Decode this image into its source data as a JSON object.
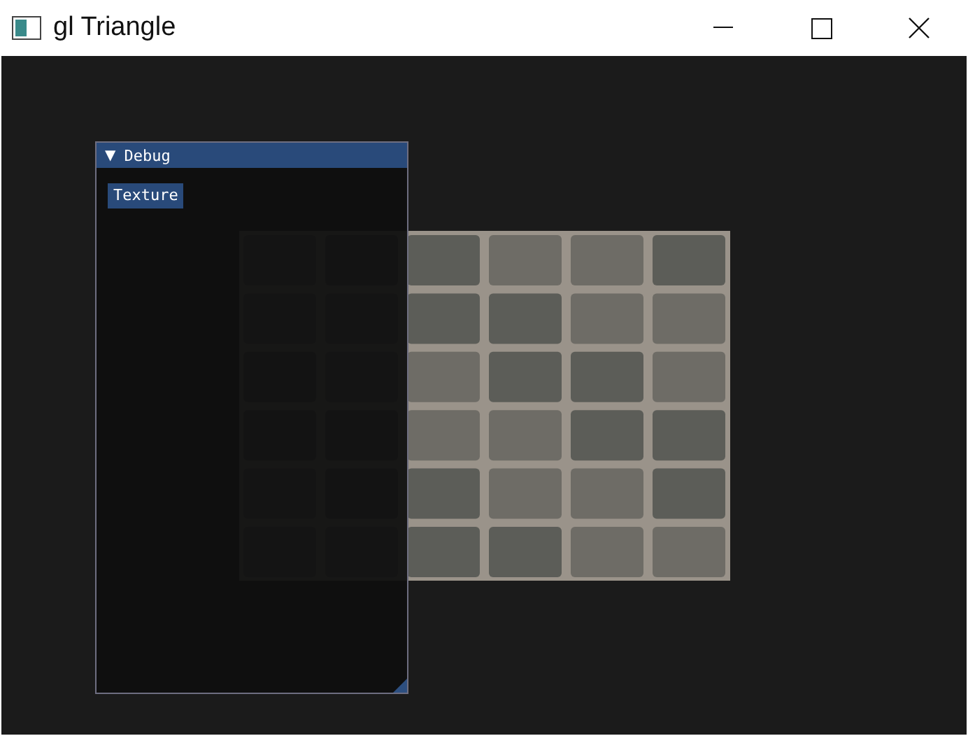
{
  "window": {
    "title": "gl Triangle"
  },
  "debug_panel": {
    "title": "Debug",
    "toggle": "▼",
    "expanded": true,
    "button": "Texture"
  }
}
